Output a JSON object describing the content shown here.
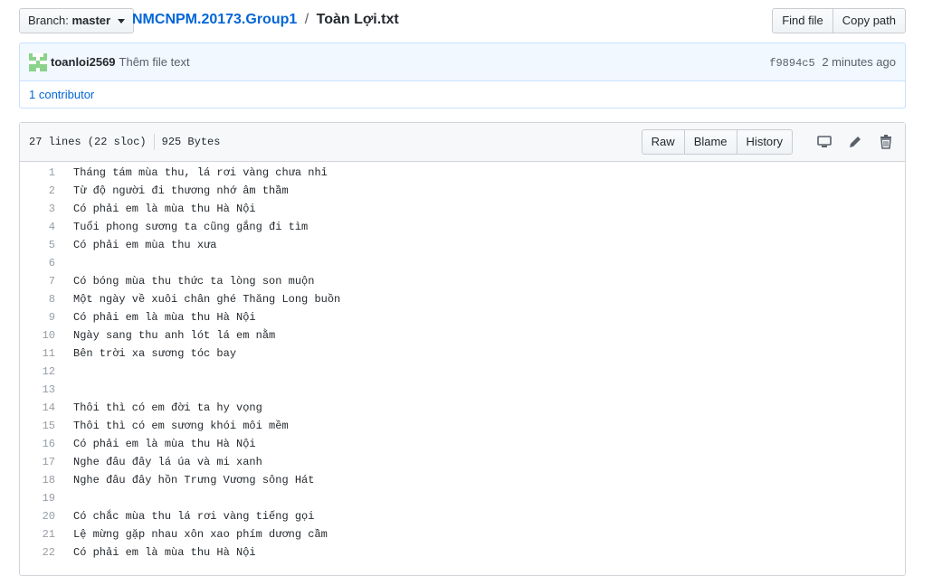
{
  "topbar": {
    "branch_prefix": "Branch:",
    "branch_name": "master",
    "repo": "NMCNPM.20173.Group1",
    "separator": "/",
    "filename": "Toàn Lợi.txt",
    "find_file": "Find file",
    "copy_path": "Copy path"
  },
  "commit": {
    "author": "toanloi2569",
    "message": "Thêm file text",
    "sha": "f9894c5",
    "time": "2 minutes ago",
    "contributors": "1 contributor"
  },
  "file": {
    "lines_info": "27 lines (22 sloc)",
    "size": "925 Bytes",
    "raw": "Raw",
    "blame": "Blame",
    "history": "History",
    "icons": [
      "desktop-icon",
      "pencil-icon",
      "trash-icon"
    ]
  },
  "lines": [
    {
      "n": "1",
      "text": "Tháng tám mùa thu, lá rơi vàng chưa nhỉ"
    },
    {
      "n": "2",
      "text": "Từ độ người đi thương nhớ âm thầm"
    },
    {
      "n": "3",
      "text": "Có phải em là mùa thu Hà Nội"
    },
    {
      "n": "4",
      "text": "Tuổi phong sương ta cũng gắng đi tìm"
    },
    {
      "n": "5",
      "text": "Có phải em mùa thu xưa"
    },
    {
      "n": "6",
      "text": ""
    },
    {
      "n": "7",
      "text": "Có bóng mùa thu thức ta lòng son muộn"
    },
    {
      "n": "8",
      "text": "Một ngày về xuôi chân ghé Thăng Long buồn"
    },
    {
      "n": "9",
      "text": "Có phải em là mùa thu Hà Nội"
    },
    {
      "n": "10",
      "text": "Ngày sang thu anh lót lá em nằm"
    },
    {
      "n": "11",
      "text": "Bên trời xa sương tóc bay"
    },
    {
      "n": "12",
      "text": ""
    },
    {
      "n": "13",
      "text": ""
    },
    {
      "n": "14",
      "text": "Thôi thì có em đời ta hy vọng"
    },
    {
      "n": "15",
      "text": "Thôi thì có em sương khói môi mềm"
    },
    {
      "n": "16",
      "text": "Có phải em là mùa thu Hà Nội"
    },
    {
      "n": "17",
      "text": "Nghe đâu đây lá úa và mi xanh"
    },
    {
      "n": "18",
      "text": "Nghe đâu đây hồn Trưng Vương sông Hát"
    },
    {
      "n": "19",
      "text": ""
    },
    {
      "n": "20",
      "text": "Có chắc mùa thu lá rơi vàng tiếng gọi"
    },
    {
      "n": "21",
      "text": "Lệ mừng gặp nhau xôn xao phím dương cầm"
    },
    {
      "n": "22",
      "text": "Có phải em là mùa thu Hà Nội"
    }
  ]
}
